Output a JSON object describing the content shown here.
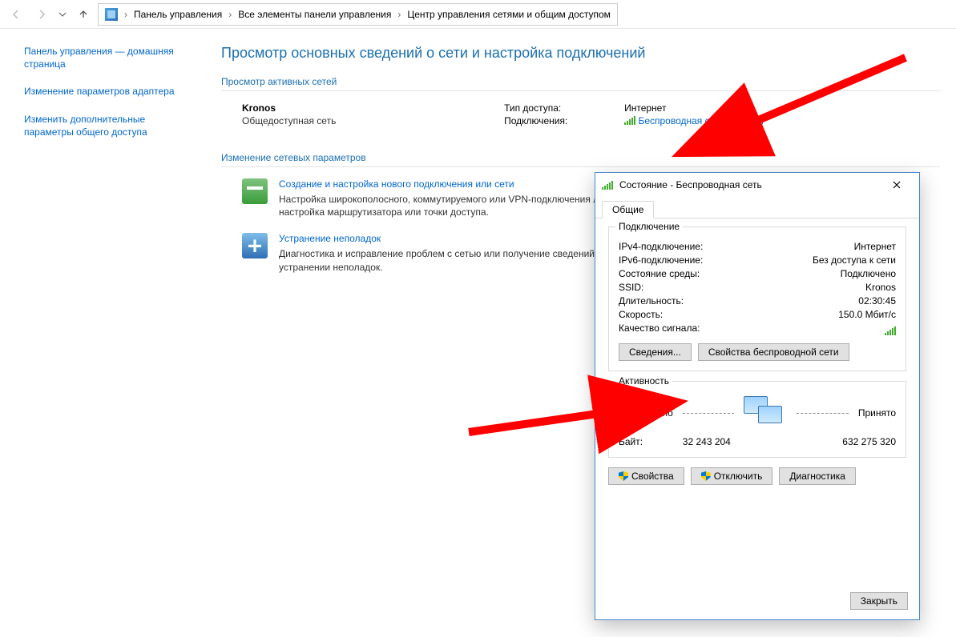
{
  "nav": {
    "crumbs": [
      "Панель управления",
      "Все элементы панели управления",
      "Центр управления сетями и общим доступом"
    ]
  },
  "sidebar": {
    "items": [
      "Панель управления — домашняя страница",
      "Изменение параметров адаптера",
      "Изменить дополнительные параметры общего доступа"
    ]
  },
  "page": {
    "title": "Просмотр основных сведений о сети и настройка подключений",
    "active_hdr": "Просмотр активных сетей",
    "change_hdr": "Изменение сетевых параметров"
  },
  "network": {
    "name": "Kronos",
    "category": "Общедоступная сеть",
    "access_label": "Тип доступа:",
    "access_value": "Интернет",
    "conn_label": "Подключения:",
    "conn_link": "Беспроводная сеть (Kronos)"
  },
  "tasks": [
    {
      "title": "Создание и настройка нового подключения или сети",
      "desc": "Настройка широкополосного, коммутируемого или VPN-подключения либо настройка маршрутизатора или точки доступа."
    },
    {
      "title": "Устранение неполадок",
      "desc": "Диагностика и исправление проблем с сетью или получение сведений об устранении неполадок."
    }
  ],
  "dialog": {
    "title": "Состояние - Беспроводная сеть",
    "tab": "Общие",
    "group_conn": "Подключение",
    "rows": {
      "ipv4_l": "IPv4-подключение:",
      "ipv4_v": "Интернет",
      "ipv6_l": "IPv6-подключение:",
      "ipv6_v": "Без доступа к сети",
      "media_l": "Состояние среды:",
      "media_v": "Подключено",
      "ssid_l": "SSID:",
      "ssid_v": "Kronos",
      "dur_l": "Длительность:",
      "dur_v": "02:30:45",
      "speed_l": "Скорость:",
      "speed_v": "150.0 Мбит/с",
      "signal_l": "Качество сигнала:"
    },
    "btn_details": "Сведения...",
    "btn_wprops": "Свойства беспроводной сети",
    "group_act": "Активность",
    "sent": "Отправлено",
    "recv": "Принято",
    "bytes_l": "Байт:",
    "bytes_sent": "32 243 204",
    "bytes_recv": "632 275 320",
    "btn_props": "Свойства",
    "btn_disable": "Отключить",
    "btn_diag": "Диагностика",
    "btn_close": "Закрыть"
  }
}
